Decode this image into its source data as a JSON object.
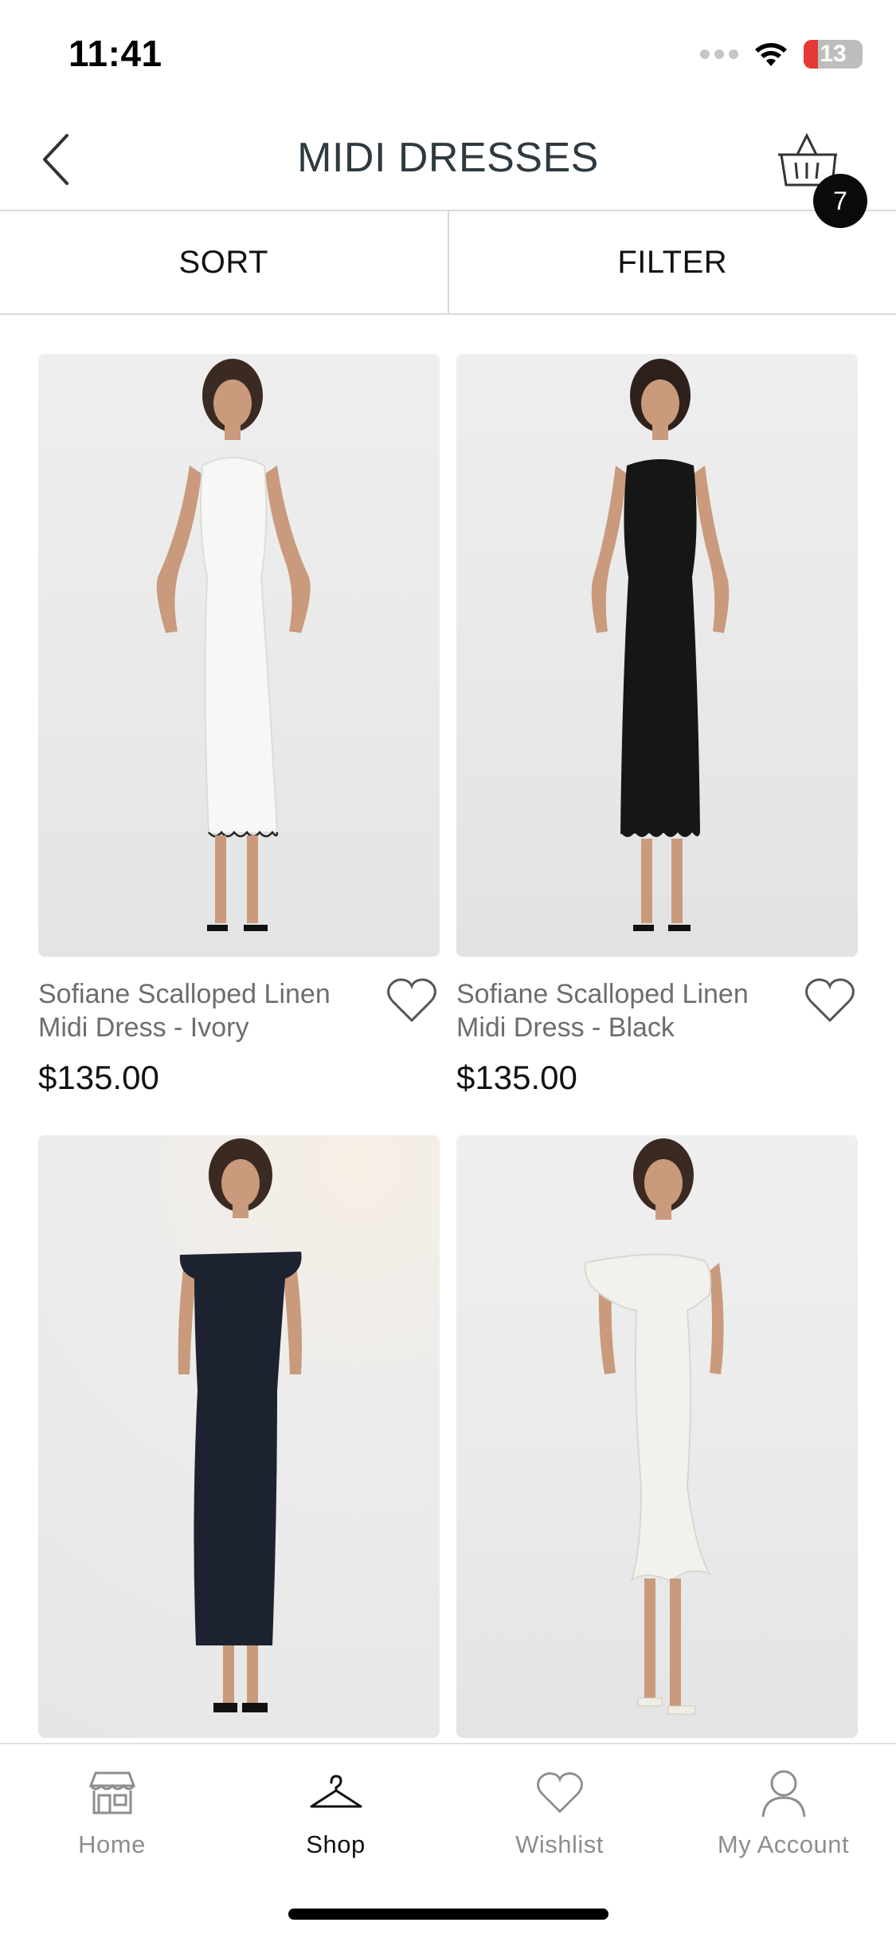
{
  "status_bar": {
    "time": "11:41",
    "battery": "13",
    "battery_color": "#e53935"
  },
  "header": {
    "title": "MIDI DRESSES",
    "back_icon": "chevron-left-icon",
    "basket_icon": "basket-icon",
    "basket_count": "7"
  },
  "toolbar": {
    "sort_label": "SORT",
    "filter_label": "FILTER"
  },
  "products": [
    {
      "name": "Sofiane Scalloped Linen Midi Dress - Ivory",
      "price": "$135.00",
      "dress_color": "#f7f7f5",
      "style": "sleeveless-scalloped"
    },
    {
      "name": "Sofiane Scalloped Linen Midi Dress - Black",
      "price": "$135.00",
      "dress_color": "#161616",
      "style": "sleeveless-scalloped"
    },
    {
      "name": "",
      "price": "",
      "dress_color": "#1d2230",
      "style": "off-shoulder-column"
    },
    {
      "name": "",
      "price": "",
      "dress_color": "#f2f1ec",
      "style": "off-shoulder-ruffle"
    }
  ],
  "tabbar": {
    "items": [
      {
        "label": "Home",
        "icon": "storefront-icon",
        "active": false
      },
      {
        "label": "Shop",
        "icon": "hanger-icon",
        "active": true
      },
      {
        "label": "Wishlist",
        "icon": "heart-icon",
        "active": false
      },
      {
        "label": "My Account",
        "icon": "user-icon",
        "active": false
      }
    ]
  },
  "colors": {
    "accent": "#0b0b0b",
    "muted_text": "#6d6d6d",
    "divider": "#d9d9d9"
  }
}
